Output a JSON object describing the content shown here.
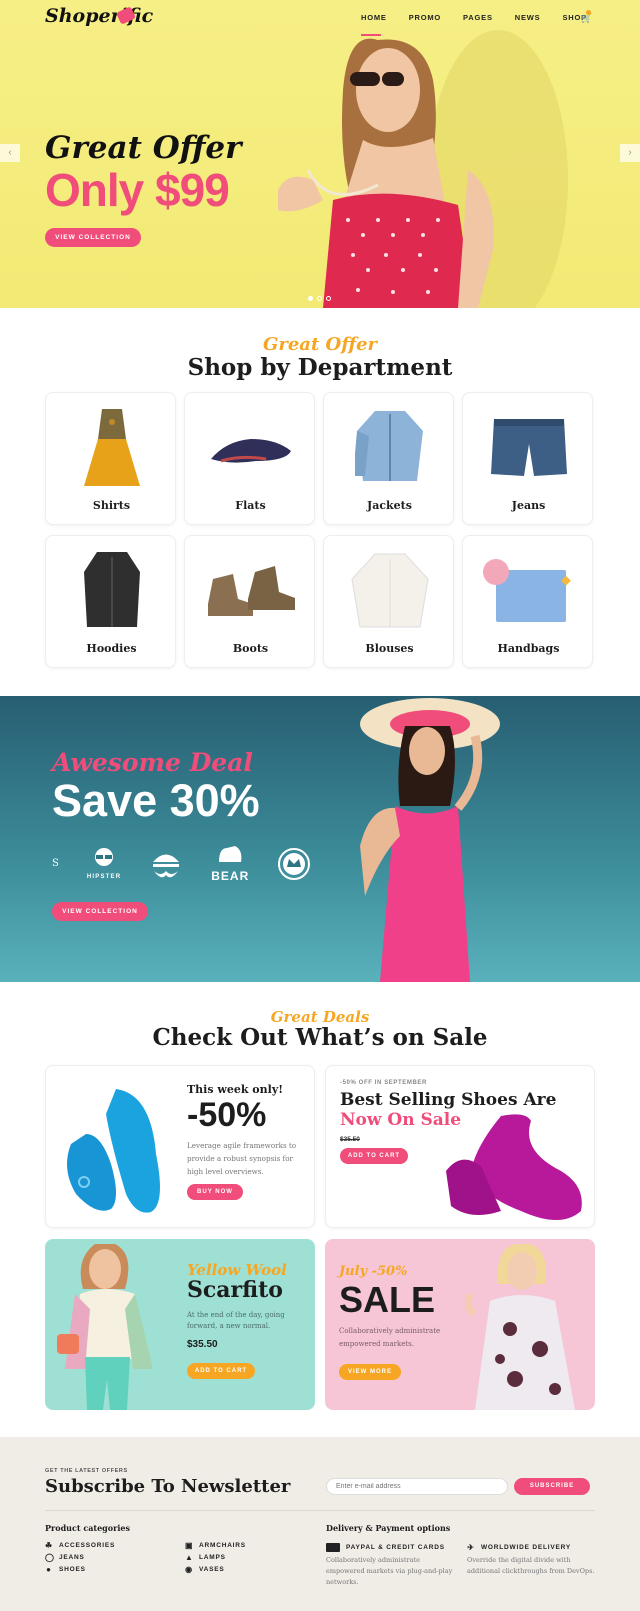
{
  "header": {
    "logo": "Shoperific",
    "nav": [
      "HOME",
      "PROMO",
      "PAGES",
      "NEWS",
      "SHOP"
    ]
  },
  "hero": {
    "script": "Great Offer",
    "price": "Only $99",
    "button": "VIEW COLLECTION",
    "prev": "‹",
    "next": "›"
  },
  "departments": {
    "eyebrow": "Great Offer",
    "title": "Shop by Department",
    "items": [
      "Shirts",
      "Flats",
      "Jackets",
      "Jeans",
      "Hoodies",
      "Boots",
      "Blouses",
      "Handbags"
    ]
  },
  "deal": {
    "script": "Awesome Deal",
    "title": "Save 30%",
    "brand_s": "S",
    "brand_hipster": "HIPSTER",
    "brand_bear": "BEAR",
    "button": "VIEW COLLECTION"
  },
  "sale": {
    "eyebrow": "Great Deals",
    "title": "Check Out What’s on Sale",
    "card1": {
      "kicker": "This week only!",
      "big": "-50%",
      "text": "Leverage agile frameworks to provide a robust synopsis for high level overviews.",
      "button": "BUY NOW"
    },
    "card2": {
      "small": "-50% OFF IN SEPTEMBER",
      "title1": "Best Selling Shoes Are",
      "title2": "Now On Sale",
      "price": "$35.50",
      "button": "ADD TO CART"
    },
    "card3": {
      "script": "Yellow Wool",
      "title": "Scarfito",
      "text": "At the end of the day, going forward, a new normal.",
      "price": "$35.50",
      "button": "ADD TO CART"
    },
    "card4": {
      "script": "July -50%",
      "title": "SALE",
      "text": "Collaboratively administrate empowered markets.",
      "button": "VIEW MORE"
    }
  },
  "newsletter": {
    "small": "GET THE LATEST OFFERS",
    "title": "Subscribe To Newsletter",
    "placeholder": "Enter e-mail address",
    "button": "SUBSCRIBE",
    "categories_title": "Product categories",
    "categories_left": [
      "ACCESSORIES",
      "JEANS",
      "SHOES"
    ],
    "categories_right": [
      "ARMCHAIRS",
      "LAMPS",
      "VASES"
    ],
    "delivery_title": "Delivery & Payment options",
    "pay_title": "PAYPAL & CREDIT CARDS",
    "pay_text": "Collaboratively administrate empowered markets via plug-and-play networks.",
    "ship_title": "WORLDWIDE DELIVERY",
    "ship_text": "Override the digital divide with additional clickthroughs from DevOps."
  },
  "colors": {
    "accent_pink": "#f04d7a",
    "accent_orange": "#f6a623",
    "hero_bg": "#f6ef86",
    "deal_bg": "#2f7483",
    "mint_card": "#9fe0d4",
    "pink_card": "#f6c6d6",
    "footer_bg": "#f0ece6"
  }
}
